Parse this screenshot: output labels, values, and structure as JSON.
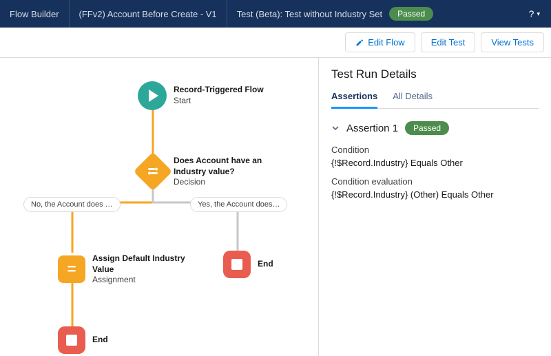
{
  "topbar": {
    "app": "Flow Builder",
    "flow_name": "(FFv2) Account Before Create - V1",
    "test_label": "Test (Beta): Test without Industry Set",
    "status": "Passed",
    "help": "?"
  },
  "actions": {
    "edit_flow": "Edit Flow",
    "edit_test": "Edit Test",
    "view_tests": "View Tests"
  },
  "flow": {
    "start": {
      "title": "Record-Triggered Flow",
      "sub": "Start"
    },
    "decision": {
      "title": "Does Account have an Industry value?",
      "sub": "Decision"
    },
    "branch_no": "No, the Account does …",
    "branch_yes": "Yes, the Account does…",
    "assignment": {
      "title": "Assign Default Industry Value",
      "sub": "Assignment"
    },
    "end": "End"
  },
  "panel": {
    "title": "Test Run Details",
    "tab_assertions": "Assertions",
    "tab_all": "All Details",
    "assertion_title": "Assertion 1",
    "assertion_status": "Passed",
    "condition_label": "Condition",
    "condition_value": "{!$Record.Industry} Equals Other",
    "eval_label": "Condition evaluation",
    "eval_value": "{!$Record.Industry} (Other) Equals Other"
  }
}
